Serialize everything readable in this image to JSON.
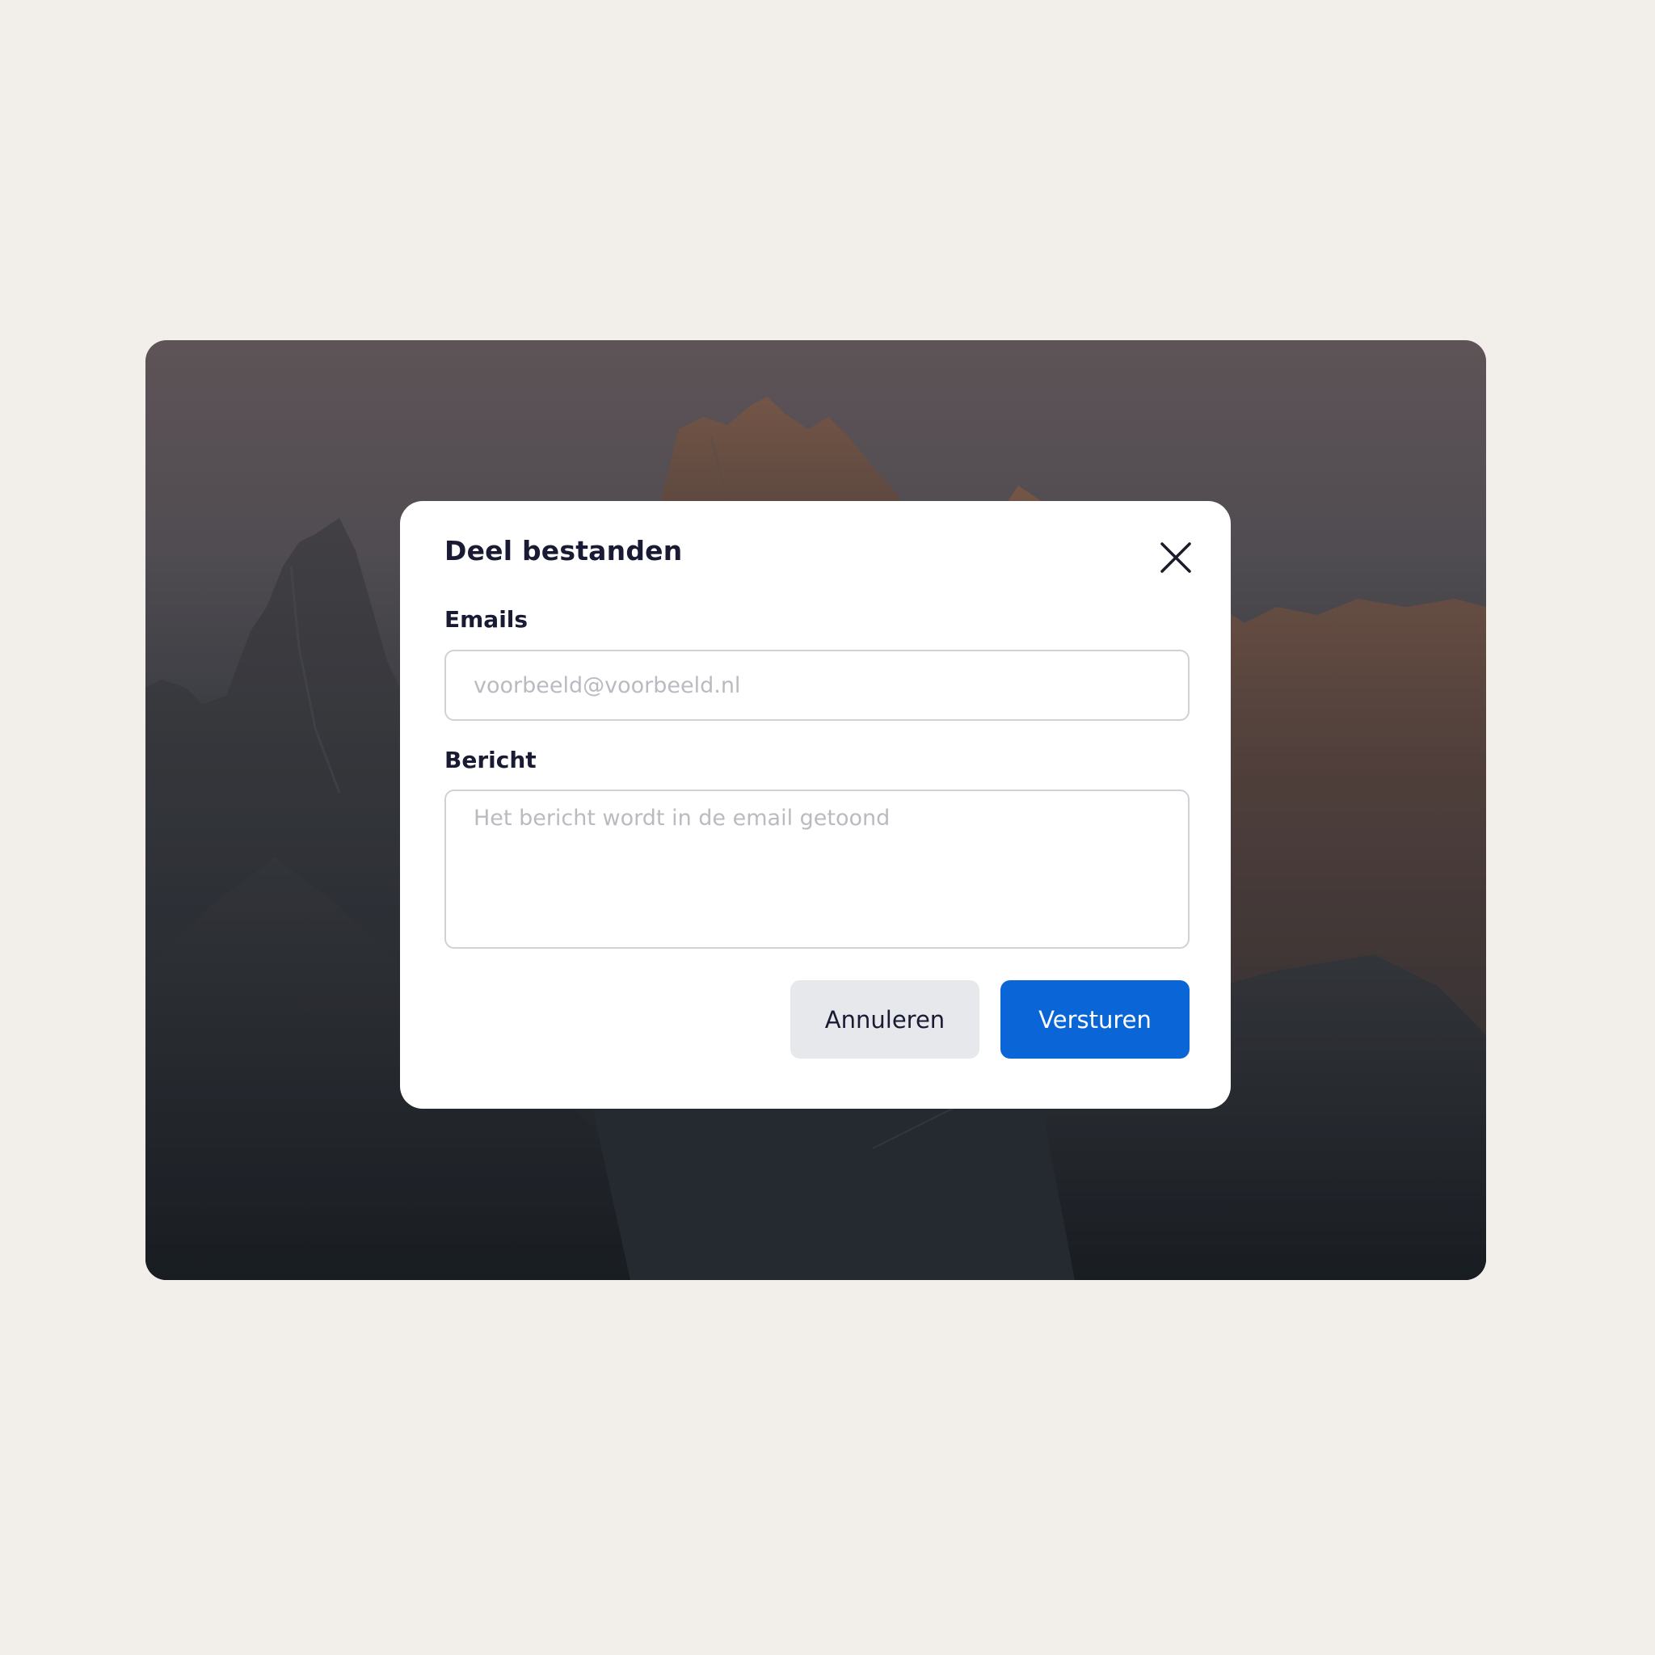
{
  "background": {
    "page_color": "#f2efea",
    "image": "mountain-landscape-photo"
  },
  "dialog": {
    "title": "Deel bestanden",
    "close_icon": "close-icon",
    "emails": {
      "label": "Emails",
      "value": "",
      "placeholder": "voorbeeld@voorbeeld.nl"
    },
    "message": {
      "label": "Bericht",
      "value": "",
      "placeholder": "Het bericht wordt in de email getoond"
    },
    "cancel_label": "Annuleren",
    "send_label": "Versturen",
    "colors": {
      "primary": "#0a66d6",
      "secondary": "#e6e8eb",
      "text": "#191a33"
    }
  }
}
